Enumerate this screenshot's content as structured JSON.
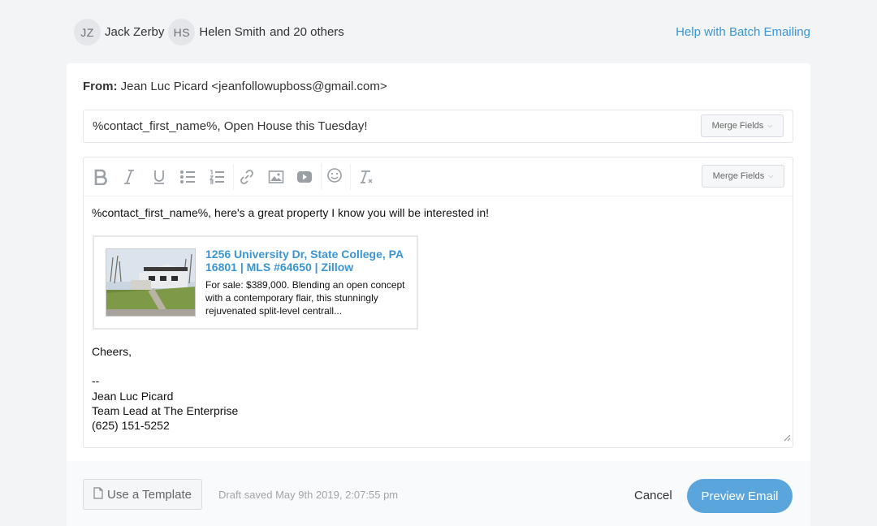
{
  "recipients": {
    "people": [
      {
        "initials": "JZ",
        "name": "Jack Zerby"
      },
      {
        "initials": "HS",
        "name": "Helen Smith"
      }
    ],
    "more_text": "and 20 others"
  },
  "help_link": "Help with Batch Emailing",
  "from": {
    "label": "From:",
    "value": "Jean Luc Picard <jeanfollowupboss@gmail.com>"
  },
  "subject": {
    "value": "%contact_first_name%, Open House this Tuesday!",
    "merge_fields_label": "Merge Fields"
  },
  "toolbar": {
    "buttons": [
      "bold-icon",
      "italic-icon",
      "underline-icon",
      "bullet-list-icon",
      "numbered-list-icon",
      "link-icon",
      "image-icon",
      "video-icon",
      "emoji-icon",
      "clear-format-icon"
    ],
    "merge_fields_label": "Merge Fields"
  },
  "body": {
    "greeting": "%contact_first_name%, here's a great property I know you will be interested in!",
    "listing": {
      "title": "1256 University Dr, State College, PA 16801 | MLS #64650 | Zillow",
      "description": "For sale: $389,000. Blending an open concept with a contemporary flair, this stunningly rejuvenated split-level centrall..."
    },
    "signoff": "Cheers,",
    "sig_dash": "--",
    "sig_name": "Jean Luc Picard",
    "sig_title": "Team Lead at The Enterprise",
    "sig_phone": "(625) 151-5252"
  },
  "footer": {
    "template_label": "Use a Template",
    "draft_status": "Draft saved May 9th 2019, 2:07:55 pm",
    "cancel_label": "Cancel",
    "preview_label": "Preview Email"
  },
  "colors": {
    "accent": "#3a95d4",
    "primary_button": "#5aa5dc"
  }
}
